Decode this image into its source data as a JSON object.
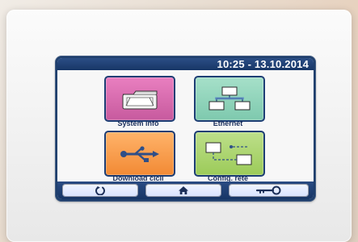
{
  "status": {
    "time_date": "10:25 - 13.10.2014"
  },
  "menu": {
    "tiles": [
      {
        "label": "System info",
        "icon": "folder-icon",
        "color": "#e97fc0"
      },
      {
        "label": "Ethernet",
        "icon": "network-icon",
        "color": "#a6e0c9"
      },
      {
        "label": "Download cicli",
        "icon": "usb-icon",
        "color": "#ffb36a"
      },
      {
        "label": "Config. rete",
        "icon": "network-settings-icon",
        "color": "#bddf8a"
      }
    ]
  },
  "nav": {
    "buttons": [
      {
        "icon": "back-icon"
      },
      {
        "icon": "home-icon"
      },
      {
        "icon": "key-icon"
      }
    ]
  },
  "colors": {
    "accent": "#173666",
    "button": "#d7e2ff",
    "text": "#1b2f5d"
  }
}
